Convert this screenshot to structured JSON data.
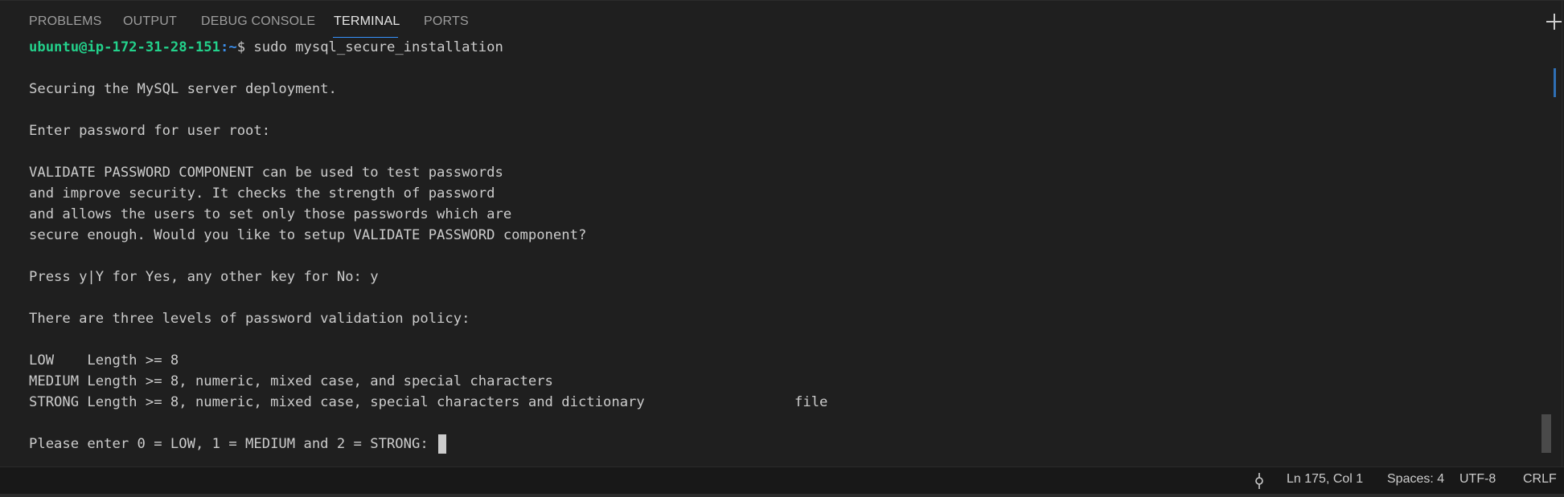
{
  "panel": {
    "tabs": [
      {
        "label": "PROBLEMS"
      },
      {
        "label": "OUTPUT"
      },
      {
        "label": "DEBUG CONSOLE"
      },
      {
        "label": "TERMINAL"
      },
      {
        "label": "PORTS"
      }
    ],
    "active_tab": "TERMINAL",
    "new_terminal_icon": "plus-icon"
  },
  "terminal": {
    "prompt_user": "ubuntu@ip-172-31-28-151",
    "prompt_sep": ":",
    "prompt_path": "~",
    "prompt_symbol": "$ ",
    "command": "sudo mysql_secure_installation",
    "lines": [
      "Securing the MySQL server deployment.",
      "Enter password for user root:",
      "VALIDATE PASSWORD COMPONENT can be used to test passwords",
      "and improve security. It checks the strength of password",
      "and allows the users to set only those passwords which are",
      "secure enough. Would you like to setup VALIDATE PASSWORD component?",
      "Press y|Y for Yes, any other key for No: y",
      "There are three levels of password validation policy:",
      "LOW    Length >= 8",
      "MEDIUM Length >= 8, numeric, mixed case, and special characters",
      "STRONG Length >= 8, numeric, mixed case, special characters and dictionary                  file",
      "Please enter 0 = LOW, 1 = MEDIUM and 2 = STRONG: "
    ]
  },
  "statusbar": {
    "sync_icon": "source-control-sync-icon",
    "position": "Ln 175, Col 1",
    "indentation": "Spaces: 4",
    "encoding": "UTF-8",
    "line_ending": "CRLF"
  },
  "colors": {
    "background": "#1f1f1f",
    "prompt_user": "#23d18b",
    "prompt_path": "#3b8eea",
    "tab_active_underline": "#3794ff",
    "statusbar_bg": "#181818"
  }
}
